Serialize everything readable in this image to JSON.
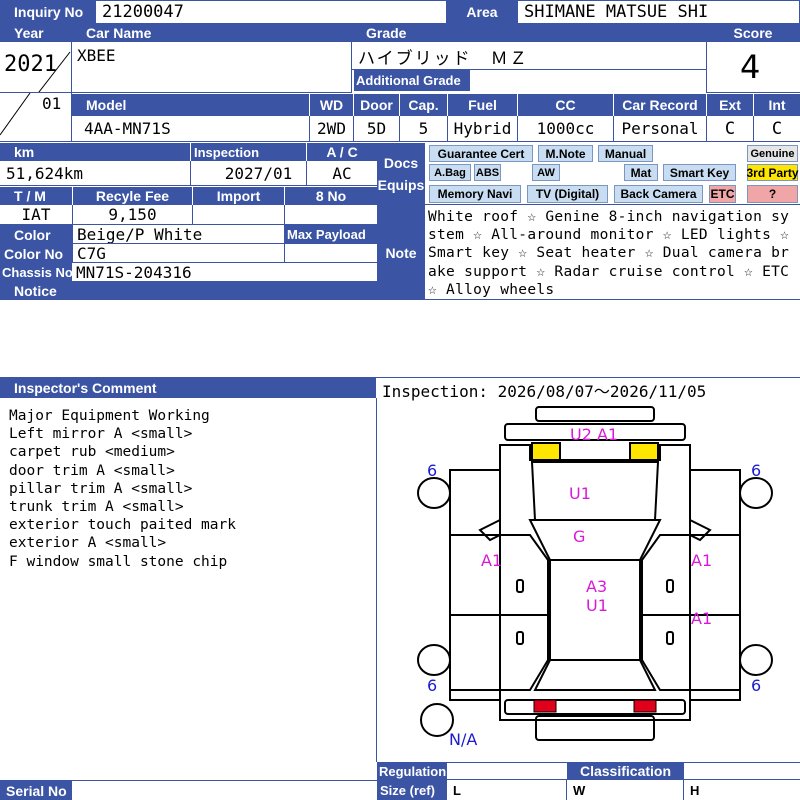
{
  "labels": {
    "inquiry_no": "Inquiry No",
    "area": "Area",
    "year": "Year",
    "car_name": "Car Name",
    "grade": "Grade",
    "score": "Score",
    "additional_grade": "Additional Grade",
    "model": "Model",
    "wd": "WD",
    "door": "Door",
    "cap": "Cap.",
    "fuel": "Fuel",
    "cc": "CC",
    "car_record": "Car Record",
    "ext": "Ext",
    "int": "Int",
    "km": "km",
    "inspection": "Inspection",
    "ac": "A / C",
    "tm": "T / M",
    "recycle_fee": "Recyle Fee",
    "import": "Import",
    "eight_no": "8 No",
    "color": "Color",
    "max_payload": "Max Payload",
    "color_no": "Color No",
    "chassis_no": "Chassis No",
    "notice": "Notice",
    "docs": "Docs",
    "equips": "Equips",
    "note": "Note",
    "inspectors_comment": "Inspector's Comment",
    "regulation": "Regulation",
    "classification": "Classification",
    "serial_no": "Serial No",
    "size_ref": "Size (ref)",
    "size_l": "L",
    "size_w": "W",
    "size_h": "H"
  },
  "values": {
    "inquiry_no": "21200047",
    "area": "SHIMANE MATSUE SHI",
    "year": "2021",
    "month": "01",
    "car_name": "XBEE",
    "grade": "ハイブリッド　ＭＺ",
    "score": "4",
    "model": "4AA-MN71S",
    "wd": "2WD",
    "door": "5D",
    "cap": "5",
    "fuel": "Hybrid",
    "cc": "1000cc",
    "car_record": "Personal",
    "ext": "C",
    "int": "C",
    "km": "51,624km",
    "inspection": "2027/01",
    "ac": "AC",
    "tm": "IAT",
    "recycle_fee": "9,150",
    "color": "Beige/P White",
    "color_no": "C7G",
    "chassis_no": "MN71S-204316",
    "note": "White roof ☆ Genine 8-inch navigation system ☆ All-around monitor ☆ LED lights ☆ Smart key ☆ Seat heater ☆ Dual camera brake support ☆ Radar cruise control ☆ ETC ☆ Alloy wheels",
    "inspection_period": "Inspection: 2026/08/07～2026/11/05"
  },
  "equipment_tags": [
    {
      "label": "Guarantee Cert",
      "active": true
    },
    {
      "label": "M.Note",
      "active": true
    },
    {
      "label": "Manual",
      "active": true
    },
    {
      "label": "Genuine",
      "active": false
    },
    {
      "label": "A.Bag",
      "active": true
    },
    {
      "label": "ABS",
      "active": true
    },
    {
      "label": "AW",
      "active": true
    },
    {
      "label": "Mat",
      "active": true
    },
    {
      "label": "Smart Key",
      "active": true
    },
    {
      "label": "3rd Party",
      "active": true
    },
    {
      "label": "Memory Navi",
      "active": true
    },
    {
      "label": "TV (Digital)",
      "active": true
    },
    {
      "label": "Back Camera",
      "active": true
    },
    {
      "label": "ETC",
      "active": true
    },
    {
      "label": "?",
      "active": true
    }
  ],
  "inspector_comments": [
    "Major Equipment Working",
    "Left mirror A <small>",
    "carpet rub <medium>",
    "door trim A <small>",
    "pillar trim A <small>",
    "trunk trim A <small>",
    "exterior touch paited mark",
    "exterior A <small>",
    "F window small stone chip"
  ],
  "diagram_marks": {
    "front": "U2  A1",
    "hood": "U1",
    "windshield": "G",
    "left_front_door": "A1",
    "right_front_door": "A1",
    "roof_1": "A3",
    "roof_2": "U1",
    "right_rear_door": "A1",
    "tire_fl": "6",
    "tire_fr": "6",
    "tire_rl": "6",
    "tire_rr": "6",
    "spare": "N/A"
  },
  "colors": {
    "header_blue": "#3b54a3",
    "tag_blue": "#c9ddf2",
    "tag_yellow": "#ffe600",
    "tag_pink": "#f0a6a6",
    "damage_magenta": "#d81ad8",
    "tire_blue": "#1b1bd0",
    "lamp_yellow": "#ffe600",
    "lamp_red": "#e0001b"
  }
}
